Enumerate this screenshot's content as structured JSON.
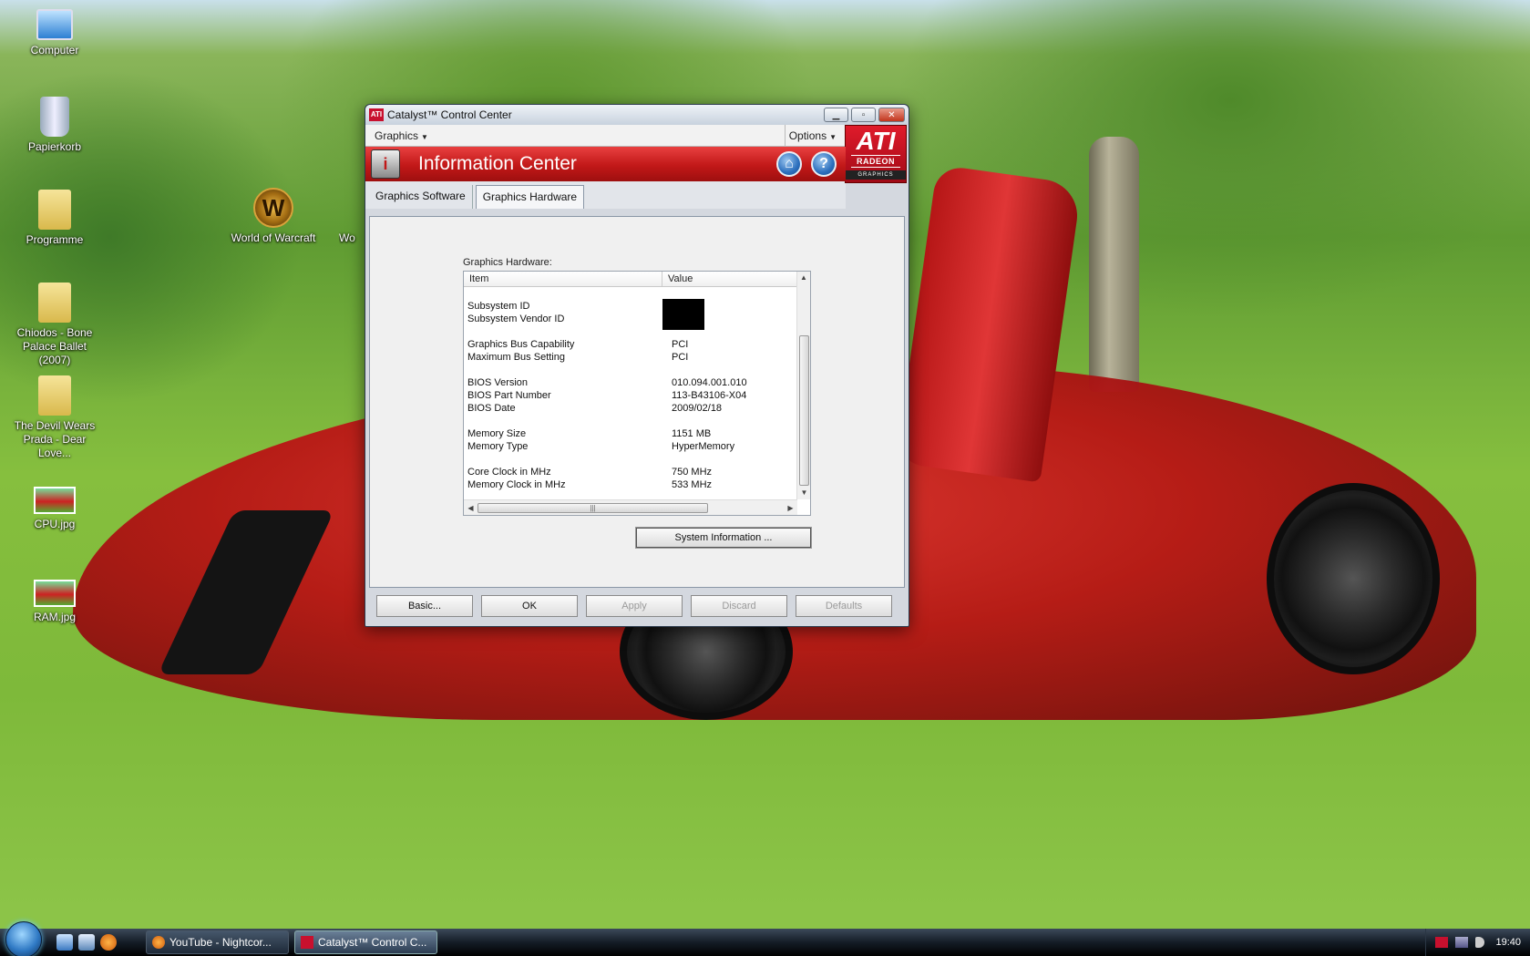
{
  "desktop": {
    "icons": [
      {
        "label": "Computer"
      },
      {
        "label": "Papierkorb"
      },
      {
        "label": "Programme"
      },
      {
        "label": "Chiodos - Bone Palace Ballet (2007)"
      },
      {
        "label": "The Devil Wears Prada - Dear Love..."
      },
      {
        "label": "CPU.jpg"
      },
      {
        "label": "RAM.jpg"
      },
      {
        "label": "World of Warcraft"
      },
      {
        "label": "Wo"
      }
    ]
  },
  "window": {
    "title": "Catalyst™ Control Center",
    "logo_text": "ATI",
    "menu": {
      "graphics": "Graphics",
      "options": "Options"
    },
    "brand": {
      "big": "ATI",
      "mid": "RADEON",
      "small": "GRAPHICS"
    },
    "banner": {
      "title": "Information Center",
      "info_glyph": "i",
      "home_glyph": "⌂",
      "help_glyph": "?"
    },
    "tabs": [
      {
        "label": "Graphics Software"
      },
      {
        "label": "Graphics Hardware"
      }
    ],
    "section_label": "Graphics Hardware:",
    "table": {
      "columns": [
        "Item",
        "Value"
      ],
      "groups": [
        [
          {
            "item": "Subsystem ID",
            "value": ""
          },
          {
            "item": "Subsystem Vendor ID",
            "value": ""
          }
        ],
        [
          {
            "item": "Graphics Bus Capability",
            "value": "PCI"
          },
          {
            "item": "Maximum Bus Setting",
            "value": "PCI"
          }
        ],
        [
          {
            "item": "BIOS Version",
            "value": "010.094.001.010"
          },
          {
            "item": "BIOS Part Number",
            "value": "113-B43106-X04"
          },
          {
            "item": "BIOS Date",
            "value": "2009/02/18"
          }
        ],
        [
          {
            "item": "Memory Size",
            "value": "1151 MB"
          },
          {
            "item": "Memory Type",
            "value": "HyperMemory"
          }
        ],
        [
          {
            "item": "Core Clock in MHz",
            "value": "750 MHz"
          },
          {
            "item": "Memory Clock in MHz",
            "value": "533 MHz"
          }
        ]
      ]
    },
    "system_info_button": "System Information ...",
    "buttons": {
      "basic": "Basic...",
      "ok": "OK",
      "apply": "Apply",
      "discard": "Discard",
      "defaults": "Defaults"
    }
  },
  "taskbar": {
    "tasks": [
      {
        "label": "YouTube - Nightcor..."
      },
      {
        "label": "Catalyst™ Control C..."
      }
    ],
    "clock": "19:40"
  },
  "colors": {
    "ati_red": "#c8102e",
    "banner_red": "#c11818"
  }
}
